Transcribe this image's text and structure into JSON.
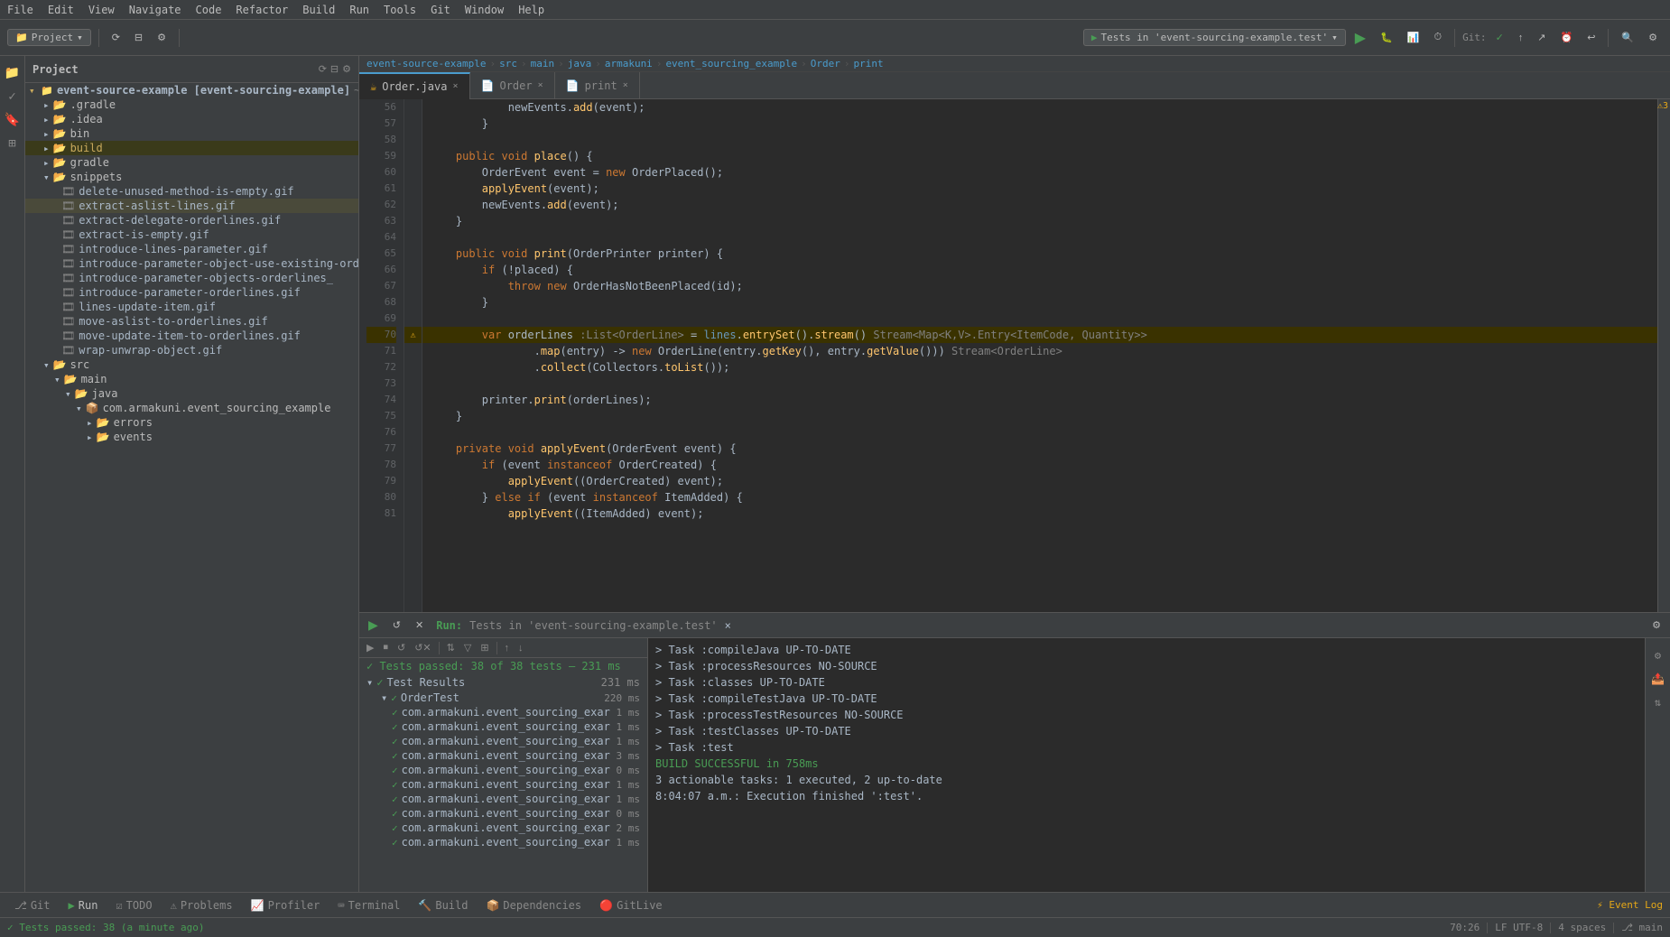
{
  "menubar": {
    "items": [
      "File",
      "Edit",
      "View",
      "Navigate",
      "Code",
      "Refactor",
      "Build",
      "Run",
      "Tools",
      "Git",
      "Window",
      "Help"
    ]
  },
  "toolbar": {
    "project_label": "Project",
    "run_config": "Tests in 'event-sourcing-example.test'",
    "git_label": "Git:"
  },
  "breadcrumb": {
    "parts": [
      "event-source-example",
      "src",
      "main",
      "java",
      "armakuni",
      "event_sourcing_example",
      "Order",
      "print"
    ]
  },
  "tabs": {
    "items": [
      {
        "label": "Order.java",
        "active": true
      },
      {
        "label": "Order",
        "active": false
      },
      {
        "label": "print",
        "active": false
      }
    ]
  },
  "file_tree": {
    "root": "event-source-example [event-sourcing-example]",
    "root_path": "~/dev/in",
    "items": [
      {
        "label": ".gradle",
        "type": "folder",
        "depth": 1
      },
      {
        "label": ".idea",
        "type": "folder",
        "depth": 1
      },
      {
        "label": "bin",
        "type": "folder",
        "depth": 1
      },
      {
        "label": "build",
        "type": "folder",
        "depth": 1,
        "highlighted": true
      },
      {
        "label": "gradle",
        "type": "folder",
        "depth": 1
      },
      {
        "label": "snippets",
        "type": "folder",
        "depth": 1,
        "expanded": true
      },
      {
        "label": "delete-unused-method-is-empty.gif",
        "type": "gif",
        "depth": 2
      },
      {
        "label": "extract-aslist-lines.gif",
        "type": "gif",
        "depth": 2,
        "selected": true
      },
      {
        "label": "extract-delegate-orderlines.gif",
        "type": "gif",
        "depth": 2
      },
      {
        "label": "extract-is-empty.gif",
        "type": "gif",
        "depth": 2
      },
      {
        "label": "introduce-lines-parameter.gif",
        "type": "gif",
        "depth": 2
      },
      {
        "label": "introduce-parameter-object-use-existing-orderlines.gi",
        "type": "gif",
        "depth": 2
      },
      {
        "label": "introduce-parameter-objects-orderlines_",
        "type": "gif",
        "depth": 2
      },
      {
        "label": "introduce-parameter-orderlines.gif",
        "type": "gif",
        "depth": 2
      },
      {
        "label": "lines-update-item.gif",
        "type": "gif",
        "depth": 2
      },
      {
        "label": "move-aslist-to-orderlines.gif",
        "type": "gif",
        "depth": 2
      },
      {
        "label": "move-update-item-to-orderlines.gif",
        "type": "gif",
        "depth": 2
      },
      {
        "label": "wrap-unwrap-object.gif",
        "type": "gif",
        "depth": 2
      },
      {
        "label": "src",
        "type": "folder",
        "depth": 1,
        "expanded": true
      },
      {
        "label": "main",
        "type": "folder",
        "depth": 2,
        "expanded": true
      },
      {
        "label": "java",
        "type": "folder",
        "depth": 3,
        "expanded": true
      },
      {
        "label": "com.armakuni.event_sourcing_example",
        "type": "package",
        "depth": 4
      },
      {
        "label": "errors",
        "type": "folder",
        "depth": 5
      },
      {
        "label": "events",
        "type": "folder",
        "depth": 5
      }
    ]
  },
  "code": {
    "lines": [
      {
        "num": 56,
        "content": "            newEvents.add(event);",
        "warning": false
      },
      {
        "num": 57,
        "content": "        }",
        "warning": false
      },
      {
        "num": 58,
        "content": "",
        "warning": false
      },
      {
        "num": 59,
        "content": "    public void place() {",
        "warning": false
      },
      {
        "num": 60,
        "content": "        OrderEvent event = new OrderPlaced();",
        "warning": false
      },
      {
        "num": 61,
        "content": "        applyEvent(event);",
        "warning": false
      },
      {
        "num": 62,
        "content": "        newEvents.add(event);",
        "warning": false
      },
      {
        "num": 63,
        "content": "    }",
        "warning": false
      },
      {
        "num": 64,
        "content": "",
        "warning": false
      },
      {
        "num": 65,
        "content": "    public void print(OrderPrinter printer) {",
        "warning": false
      },
      {
        "num": 66,
        "content": "        if (!placed) {",
        "warning": false
      },
      {
        "num": 67,
        "content": "            throw new OrderHasNotBeenPlaced(id);",
        "warning": false
      },
      {
        "num": 68,
        "content": "        }",
        "warning": false
      },
      {
        "num": 69,
        "content": "",
        "warning": false
      },
      {
        "num": 70,
        "content": "        var orderLines :List<OrderLine> = lines.entrySet().stream() Stream<Map<K,V>.Entry<ItemCode, Quantity>>",
        "warning": true
      },
      {
        "num": 71,
        "content": "                .map(entry) -> new OrderLine(entry.getKey(), entry.getValue())) Stream<OrderLine>",
        "warning": false
      },
      {
        "num": 72,
        "content": "                .collect(Collectors.toList());",
        "warning": false
      },
      {
        "num": 73,
        "content": "",
        "warning": false
      },
      {
        "num": 74,
        "content": "        printer.print(orderLines);",
        "warning": false
      },
      {
        "num": 75,
        "content": "    }",
        "warning": false
      },
      {
        "num": 76,
        "content": "",
        "warning": false
      },
      {
        "num": 77,
        "content": "    private void applyEvent(OrderEvent event) {",
        "warning": false
      },
      {
        "num": 78,
        "content": "        if (event instanceof OrderCreated) {",
        "warning": false
      },
      {
        "num": 79,
        "content": "            applyEvent((OrderCreated) event);",
        "warning": false
      },
      {
        "num": 80,
        "content": "        } else if (event instanceof ItemAdded) {",
        "warning": false
      },
      {
        "num": 81,
        "content": "            applyEvent((ItemAdded) event);",
        "warning": false
      }
    ]
  },
  "bottom_panel": {
    "run_label": "Run:",
    "run_config": "Tests in 'event-sourcing-example.test'",
    "summary": "Tests passed: 38 of 38 tests – 231 ms",
    "test_results_label": "Test Results",
    "test_results_time": "231 ms",
    "tests": [
      {
        "label": "OrderTest",
        "time": "220 ms",
        "status": "pass"
      },
      {
        "label": "com.armakuni.event_sourcing_exar",
        "time": "1 ms",
        "status": "pass"
      },
      {
        "label": "com.armakuni.event_sourcing_exar",
        "time": "1 ms",
        "status": "pass"
      },
      {
        "label": "com.armakuni.event_sourcing_exar",
        "time": "1 ms",
        "status": "pass"
      },
      {
        "label": "com.armakuni.event_sourcing_exar",
        "time": "3 ms",
        "status": "pass"
      },
      {
        "label": "com.armakuni.event_sourcing_exar",
        "time": "0 ms",
        "status": "pass"
      },
      {
        "label": "com.armakuni.event_sourcing_exar",
        "time": "1 ms",
        "status": "pass"
      },
      {
        "label": "com.armakuni.event_sourcing_exar",
        "time": "1 ms",
        "status": "pass"
      },
      {
        "label": "com.armakuni.event_sourcing_exar",
        "time": "0 ms",
        "status": "pass"
      },
      {
        "label": "com.armakuni.event_sourcing_exar",
        "time": "2 ms",
        "status": "pass"
      },
      {
        "label": "com.armakuni.event_sourcing_exar",
        "time": "1 ms",
        "status": "pass"
      }
    ],
    "console": [
      "> Task :compileJava UP-TO-DATE",
      "> Task :processResources NO-SOURCE",
      "> Task :classes UP-TO-DATE",
      "> Task :compileTestJava UP-TO-DATE",
      "> Task :processTestResources NO-SOURCE",
      "> Task :testClasses UP-TO-DATE",
      "> Task :test",
      "BUILD SUCCESSFUL in 758ms",
      "3 actionable tasks: 1 executed, 2 up-to-date",
      "8:04:07 a.m.: Execution finished ':test'."
    ]
  },
  "status_bar": {
    "message": "Tests passed: 38 (a minute ago)",
    "position": "70:26",
    "encoding": "LF  UTF-8",
    "indent": "4 spaces",
    "branch": "main",
    "errors": "3"
  },
  "bottom_tabs": [
    {
      "label": "Git",
      "icon": "git"
    },
    {
      "label": "Run",
      "icon": "run",
      "active": true
    },
    {
      "label": "TODO",
      "icon": "todo"
    },
    {
      "label": "Problems",
      "icon": "problems"
    },
    {
      "label": "Profiler",
      "icon": "profiler"
    },
    {
      "label": "Terminal",
      "icon": "terminal"
    },
    {
      "label": "Build",
      "icon": "build"
    },
    {
      "label": "Dependencies",
      "icon": "dependencies"
    },
    {
      "label": "GitLive",
      "icon": "gitlive"
    }
  ]
}
